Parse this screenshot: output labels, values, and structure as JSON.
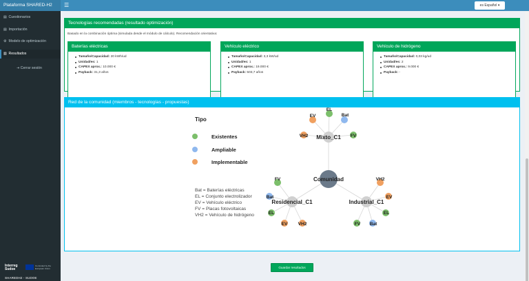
{
  "header": {
    "brand": "Plataforma SHARED-H2",
    "toggle_icon": "☰",
    "language": "es Español"
  },
  "sidebar": {
    "items": [
      {
        "icon": "▤",
        "label": "Cuestionarios"
      },
      {
        "icon": "▤",
        "label": "Importación"
      },
      {
        "icon": "⚙",
        "label": "Modelo de optimización"
      },
      {
        "icon": "▥",
        "label": "Resultados"
      }
    ],
    "logout": "Cerrar sesión",
    "footer": {
      "interreg": "Interreg",
      "sudoe": "Sudoe",
      "eu_text": "Co-funded by the European Union",
      "project": "SHAREDH2 - SUDOE"
    }
  },
  "tech": {
    "title": "Tecnologías recomendadas (resultado optimización)",
    "note": "Basado en la combinación óptima (simulada desde el módulo de cálculo). Recomendación orientativa:",
    "cards": [
      {
        "title": "Baterías eléctricas",
        "rows": [
          {
            "label": "Tamaño/Capacidad:",
            "value": "20 kWh/ud"
          },
          {
            "label": "Unidad/es:",
            "value": "1"
          },
          {
            "label": "CAPEX aprox.:",
            "value": "10.000 €"
          },
          {
            "label": "Payback:",
            "value": "31,3 años"
          }
        ]
      },
      {
        "title": "Vehículo eléctrico",
        "rows": [
          {
            "label": "Tamaño/Capacidad:",
            "value": "3,3 kW/ud"
          },
          {
            "label": "Unidad/es:",
            "value": "1"
          },
          {
            "label": "CAPEX aprox.:",
            "value": "19.000 €"
          },
          {
            "label": "Payback:",
            "value": "503,7 años"
          }
        ]
      },
      {
        "title": "Vehículo de hidrógeno",
        "rows": [
          {
            "label": "Tamaño/Capacidad:",
            "value": "0,03 kg/ud"
          },
          {
            "label": "Unidad/es:",
            "value": "2"
          },
          {
            "label": "CAPEX aprox.:",
            "value": "9.000 €"
          },
          {
            "label": "Payback:",
            "value": "-"
          }
        ]
      }
    ]
  },
  "network": {
    "title": "Red de la comunidad (miembros - tecnologías - propuestas)",
    "legend_title": "Tipo",
    "legend": [
      {
        "label": "Existentes",
        "color": "#7cbf6b"
      },
      {
        "label": "Ampliable",
        "color": "#8fb8ee"
      },
      {
        "label": "Implementable",
        "color": "#f0a060"
      }
    ],
    "abbreviations": [
      "Bat = Baterías eléctricas",
      "EL = Conjunto electrolizador",
      "EV = Vehículo eléctrico",
      "FV = Placas fotovoltaicas",
      "VH2 = Vehículo de hidrógeno"
    ],
    "hub": "Comunidad",
    "members": [
      "Mixto_C1",
      "Residencial_C1",
      "Industrial_C1"
    ],
    "tech_nodes": {
      "Mixto_C1": [
        {
          "label": "EL",
          "status": "Existentes"
        },
        {
          "label": "Bat",
          "status": "Ampliable"
        },
        {
          "label": "EV",
          "status": "Implementable"
        },
        {
          "label": "VH2",
          "status": "Implementable"
        },
        {
          "label": "FV",
          "status": "Existentes"
        }
      ],
      "Residencial_C1": [
        {
          "label": "FV",
          "status": "Existentes"
        },
        {
          "label": "Bat",
          "status": "Ampliable"
        },
        {
          "label": "EL",
          "status": "Existentes"
        },
        {
          "label": "EV",
          "status": "Implementable"
        },
        {
          "label": "VH2",
          "status": "Implementable"
        }
      ],
      "Industrial_C1": [
        {
          "label": "VH2",
          "status": "Implementable"
        },
        {
          "label": "EV",
          "status": "Implementable"
        },
        {
          "label": "EL",
          "status": "Existentes"
        },
        {
          "label": "FV",
          "status": "Existentes"
        },
        {
          "label": "Bat",
          "status": "Ampliable"
        }
      ]
    }
  },
  "submit_button": "Guardar resultados",
  "colors": {
    "primary": "#3c8dbc",
    "success": "#00a65a",
    "info": "#00c0ef",
    "sidebar": "#222d32"
  }
}
